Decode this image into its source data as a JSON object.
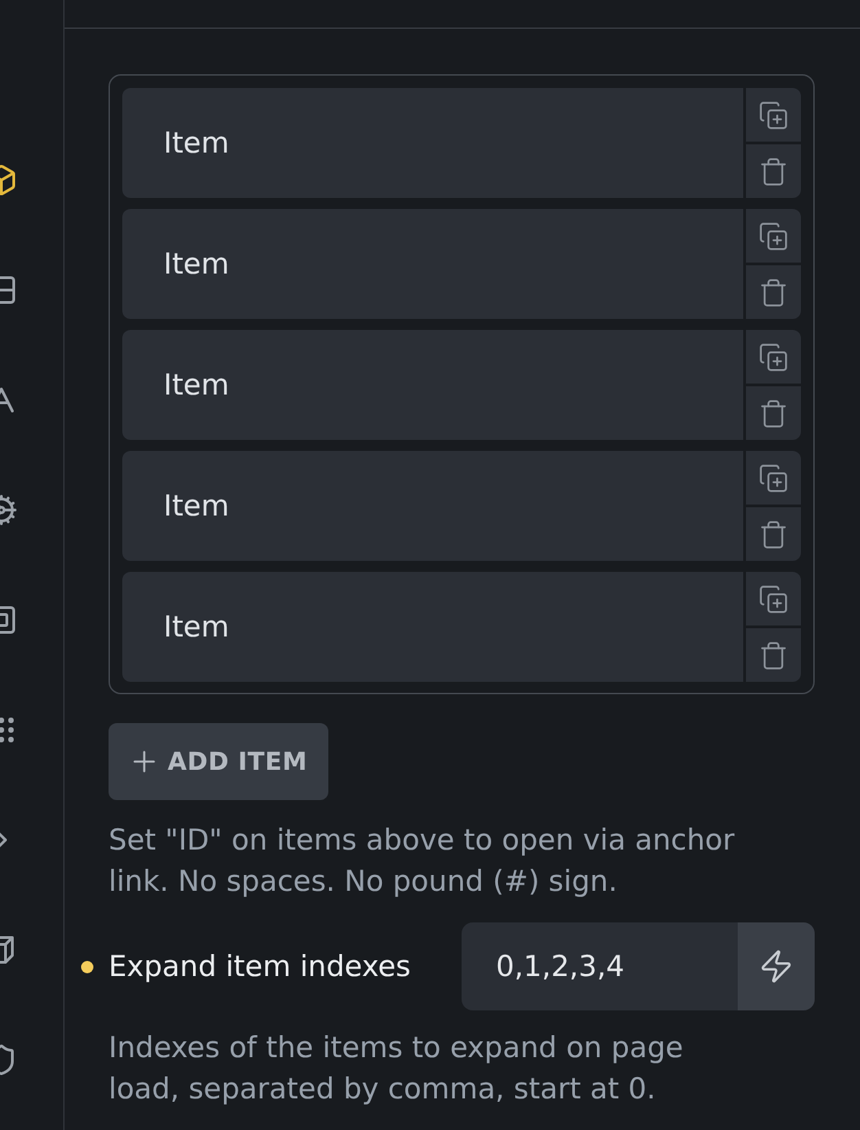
{
  "sidebar": {
    "items": [
      {
        "selected": true
      },
      {
        "selected": false
      },
      {
        "selected": false
      },
      {
        "selected": false
      },
      {
        "selected": false
      },
      {
        "selected": false
      },
      {
        "selected": false
      },
      {
        "selected": false
      },
      {
        "selected": false
      }
    ]
  },
  "items": [
    {
      "label": "Item"
    },
    {
      "label": "Item"
    },
    {
      "label": "Item"
    },
    {
      "label": "Item"
    },
    {
      "label": "Item"
    }
  ],
  "add_button": {
    "label": "ADD ITEM"
  },
  "anchor_hint": "Set \"ID\" on items above to open via anchor link. No spaces. No pound (#) sign.",
  "expand_field": {
    "label": "Expand item indexes",
    "modified": true,
    "value": "0,1,2,3,4",
    "hint": "Indexes of the items to expand on page load, separated by comma, start at 0."
  }
}
